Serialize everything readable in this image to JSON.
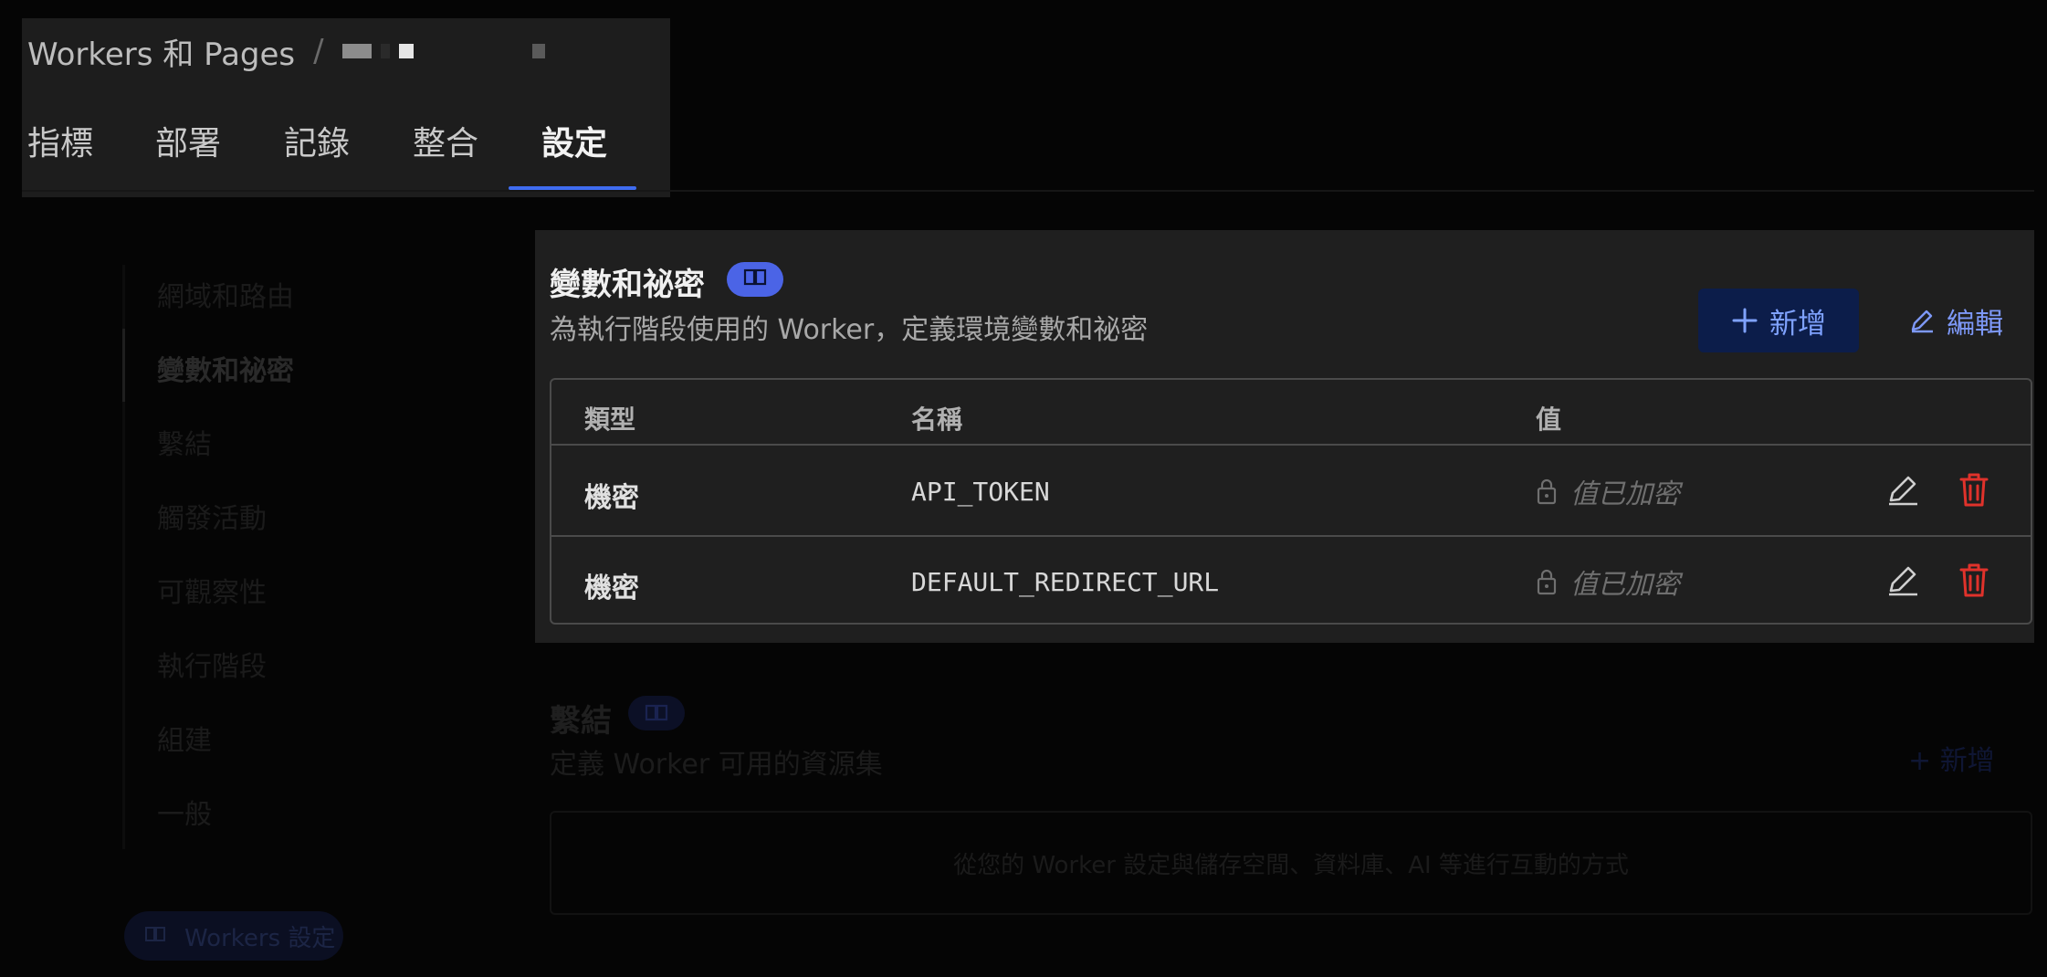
{
  "breadcrumb": {
    "root": "Workers 和 Pages",
    "separator": "/"
  },
  "tabs": [
    {
      "label": "指標"
    },
    {
      "label": "部署"
    },
    {
      "label": "記錄"
    },
    {
      "label": "整合"
    },
    {
      "label": "設定",
      "active": true
    }
  ],
  "sidebar": {
    "items": [
      {
        "label": "網域和路由"
      },
      {
        "label": "變數和祕密",
        "active": true
      },
      {
        "label": "繫結"
      },
      {
        "label": "觸發活動"
      },
      {
        "label": "可觀察性"
      },
      {
        "label": "執行階段"
      },
      {
        "label": "組建"
      },
      {
        "label": "一般"
      }
    ],
    "docs_pill": "Workers 設定"
  },
  "variables": {
    "title": "變數和祕密",
    "description": "為執行階段使用的 Worker，定義環境變數和祕密",
    "add_label": "新增",
    "edit_label": "編輯",
    "columns": [
      "類型",
      "名稱",
      "值"
    ],
    "rows": [
      {
        "type": "機密",
        "name": "API_TOKEN",
        "value": "值已加密"
      },
      {
        "type": "機密",
        "name": "DEFAULT_REDIRECT_URL",
        "value": "值已加密"
      }
    ]
  },
  "bindings": {
    "title": "繫結",
    "description": "定義 Worker 可用的資源集",
    "add_label": "新增",
    "empty_text": "從您的 Worker 設定與儲存空間、資料庫、AI 等進行互動的方式"
  },
  "colors": {
    "accent": "#3f6cf0",
    "delete": "#e0322b",
    "card": "#1f1f1f"
  }
}
